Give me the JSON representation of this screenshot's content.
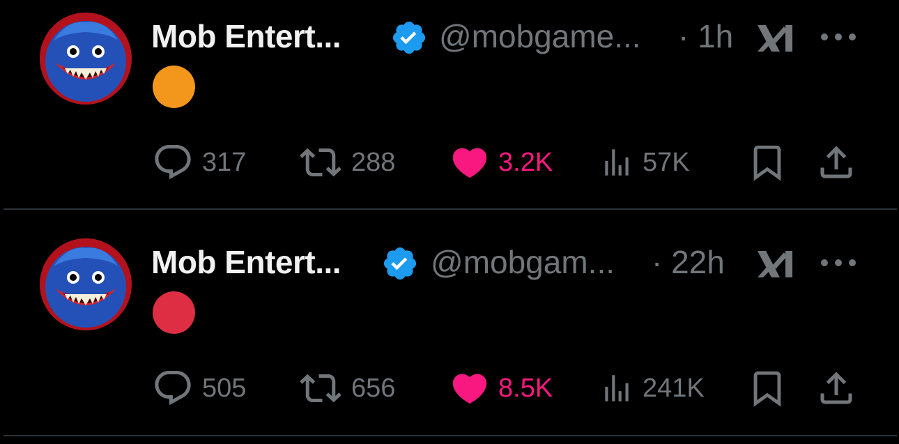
{
  "tweets": [
    {
      "author_name": "Mob Entert...",
      "handle": "@mobgame...",
      "time": "· 1h",
      "circle_color": "#f2971b",
      "replies": "317",
      "reposts": "288",
      "likes": "3.2K",
      "views": "57K"
    },
    {
      "author_name": "Mob Entert...",
      "handle": "@mobgam...",
      "time": "· 22h",
      "circle_color": "#dd2e44",
      "replies": "505",
      "reposts": "656",
      "likes": "8.5K",
      "views": "241K"
    }
  ],
  "colors": {
    "verified": "#1d9bf0",
    "like": "#f91880",
    "muted": "#71767b"
  },
  "icons": [
    "avatar",
    "verified-badge-icon",
    "grok-icon",
    "more-icon",
    "reply-icon",
    "repost-icon",
    "like-icon",
    "views-icon",
    "bookmark-icon",
    "share-icon"
  ]
}
